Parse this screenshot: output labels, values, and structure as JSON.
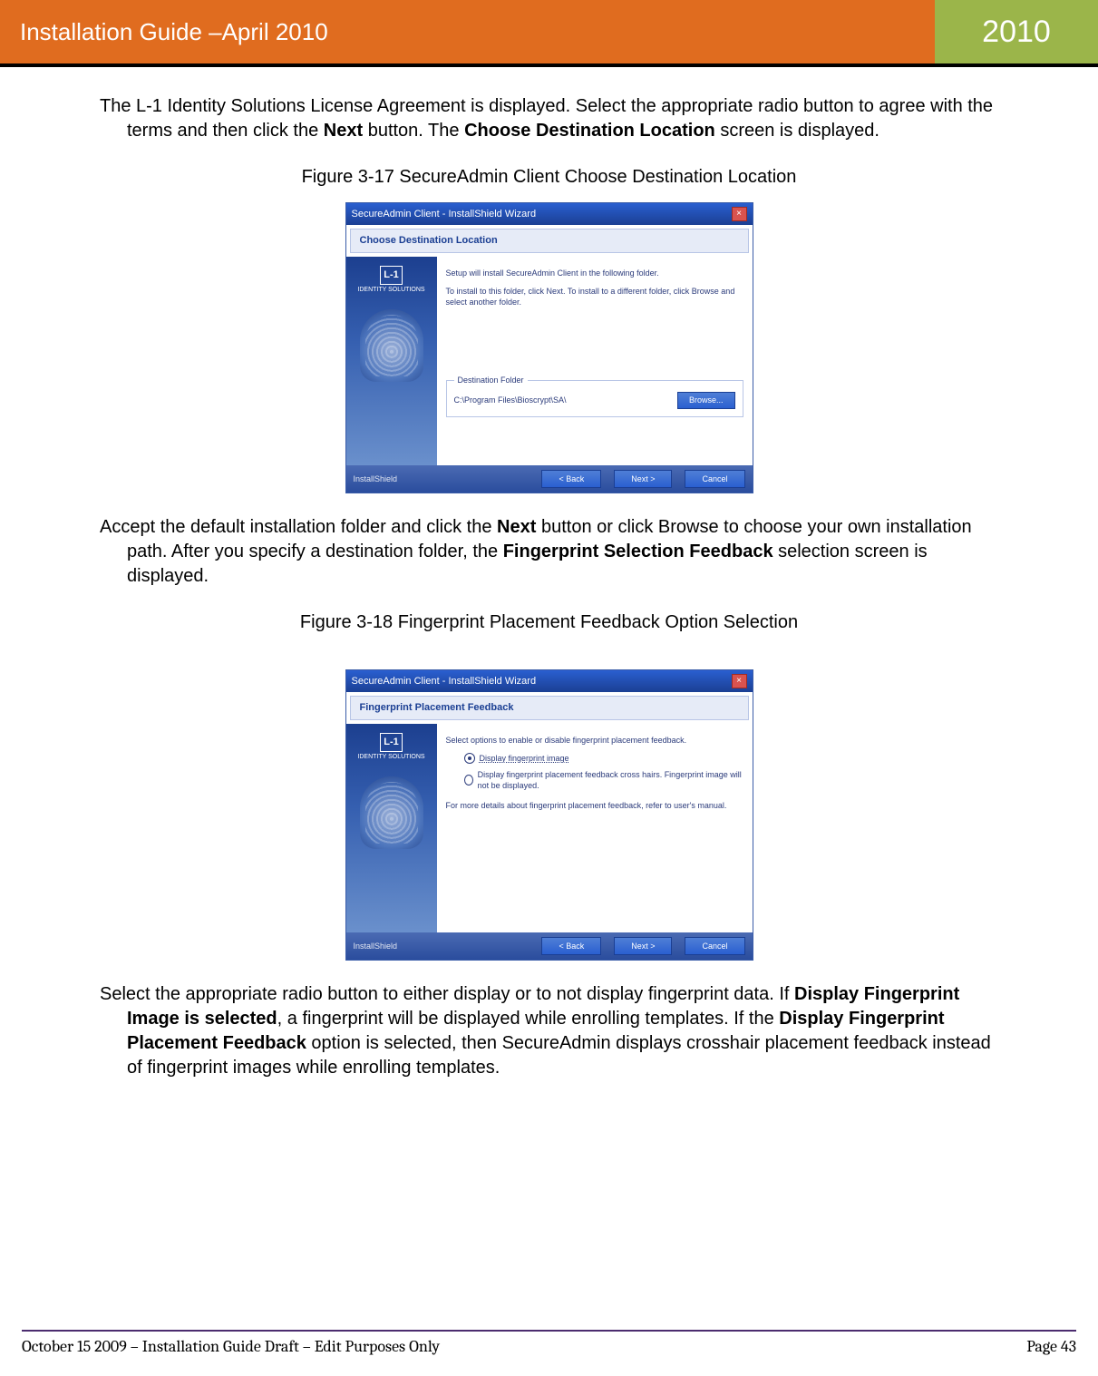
{
  "header": {
    "left": "Installation Guide –April 2010",
    "right": "2010"
  },
  "body": {
    "para1_a": "The L-1 Identity Solutions License Agreement is displayed. Select the appropriate radio button to agree with the terms and then click the ",
    "para1_b": "Next",
    "para1_c": " button. The ",
    "para1_d": "Choose Destination Location",
    "para1_e": " screen is displayed.",
    "caption1": "Figure 3-17 SecureAdmin Client Choose Destination Location",
    "para2_a": "Accept the default installation folder and click the ",
    "para2_b": "Next",
    "para2_c": " button or click Browse to choose your own installation path. After you specify a destination folder, the ",
    "para2_d": "Fingerprint Selection Feedback",
    "para2_e": " selection screen is displayed.",
    "caption2": "Figure 3-18 Fingerprint Placement Feedback Option Selection",
    "para3_a": "Select the appropriate radio button to either display or to not display fingerprint data. If ",
    "para3_b": "Display Fingerprint Image is selected",
    "para3_c": ", a fingerprint will be displayed while enrolling templates. If the ",
    "para3_d": "Display Fingerprint Placement Feedback",
    "para3_e": " option is selected, then SecureAdmin displays crosshair placement feedback instead of fingerprint images while enrolling templates."
  },
  "screenshot1": {
    "title": "SecureAdmin Client - InstallShield Wizard",
    "subtitle": "Choose Destination Location",
    "logo": "L-1",
    "logo_sub": "IDENTITY SOLUTIONS",
    "line1": "Setup will install SecureAdmin Client in the following folder.",
    "line2": "To install to this folder, click Next. To install to a different folder, click Browse and select another folder.",
    "dest_label": "Destination Folder",
    "dest_path": "C:\\Program Files\\Bioscrypt\\SA\\",
    "browse": "Browse...",
    "footer_label": "InstallShield",
    "back": "< Back",
    "next": "Next >",
    "cancel": "Cancel"
  },
  "screenshot2": {
    "title": "SecureAdmin Client - InstallShield Wizard",
    "subtitle": "Fingerprint Placement Feedback",
    "logo": "L-1",
    "logo_sub": "IDENTITY SOLUTIONS",
    "line1": "Select options to enable or disable fingerprint placement feedback.",
    "opt1": "Display fingerprint image",
    "opt2": "Display fingerprint placement feedback cross hairs. Fingerprint image will not be displayed.",
    "line2": "For more details about fingerprint placement feedback, refer to user's manual.",
    "footer_label": "InstallShield",
    "back": "< Back",
    "next": "Next >",
    "cancel": "Cancel"
  },
  "footer": {
    "left": "October 15 2009 – Installation Guide Draft – Edit Purposes Only",
    "right": "Page 43"
  }
}
